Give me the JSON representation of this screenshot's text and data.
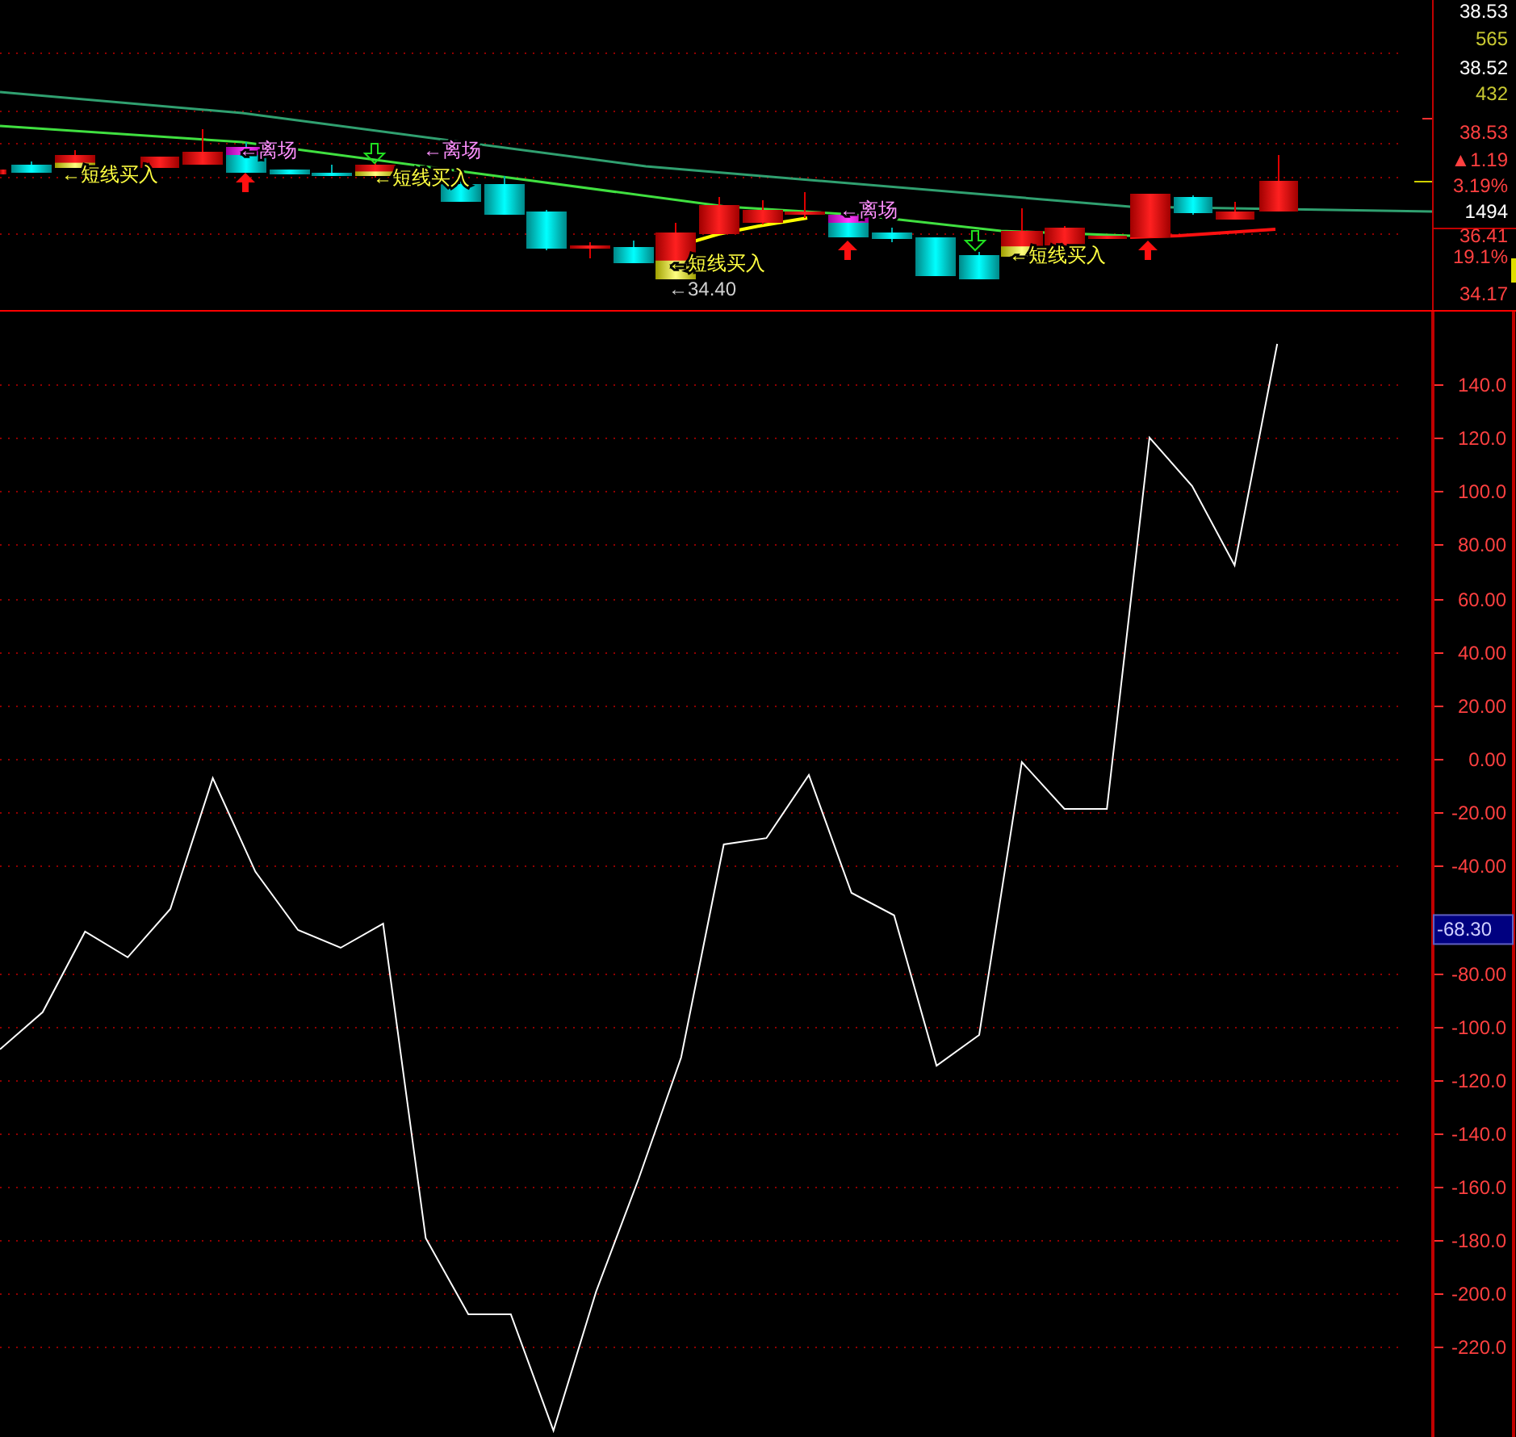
{
  "price_panel": {
    "axis_labels": [
      {
        "text": "38.53",
        "color": "#ffffff"
      },
      {
        "text": "565",
        "color": "#c8c832"
      },
      {
        "text": "38.52",
        "color": "#ffffff"
      },
      {
        "text": "432",
        "color": "#c8c832"
      },
      {
        "text": "38.53",
        "color": "#ff4040"
      },
      {
        "text": "▲1.19",
        "color": "#ff4040"
      },
      {
        "text": "3.19%",
        "color": "#ff4040"
      },
      {
        "text": "1494",
        "color": "#ffffff"
      },
      {
        "text": "36.41",
        "color": "#ff4040"
      },
      {
        "text": "19.1%",
        "color": "#ff4040"
      },
      {
        "text": "34.17",
        "color": "#ff4040"
      }
    ],
    "signals": [
      {
        "text": "←短线买入",
        "kind": "buy"
      },
      {
        "text": "←离场",
        "kind": "exit"
      },
      {
        "text": "←短线买入",
        "kind": "buy"
      },
      {
        "text": "←离场",
        "kind": "exit"
      },
      {
        "text": "←短线买入",
        "kind": "buy"
      },
      {
        "text": "←离场",
        "kind": "exit"
      },
      {
        "text": "←短线买入",
        "kind": "buy"
      }
    ],
    "low_marker": "←34.40"
  },
  "indicator_panel": {
    "cursor_value": "-68.30",
    "chart_data": {
      "type": "line",
      "categories": [
        null,
        null,
        null,
        null,
        null,
        null,
        null,
        null,
        null,
        null,
        null,
        null,
        null,
        null,
        null,
        null,
        null,
        null,
        null,
        null,
        null,
        null,
        null,
        null,
        null,
        null,
        null,
        null,
        null,
        null,
        null
      ],
      "series": [
        {
          "color": "#ffffff",
          "values": [
            -108.6,
            -94.7,
            -64.6,
            -74.2,
            -56.1,
            -7.2,
            -42.2,
            -64.0,
            -70.6,
            -61.6,
            -179.2,
            -207.6,
            -207.6,
            -251.1,
            -199.2,
            -156.9,
            -111.6,
            -32.0,
            -29.6,
            -6.0,
            -50.1,
            -58.5,
            -114.7,
            -103.2,
            -1.2,
            -18.7,
            -18.7,
            120.1,
            102.0,
            72.4,
            155.1
          ]
        }
      ],
      "grid": true,
      "ylim": [
        -253.5,
        167.2
      ],
      "yticks": [
        {
          "value": 140,
          "label": "140.0"
        },
        {
          "value": 120,
          "label": "120.0"
        },
        {
          "value": 100,
          "label": "100.0"
        },
        {
          "value": 80,
          "label": "80.00"
        },
        {
          "value": 60,
          "label": "60.00"
        },
        {
          "value": 40,
          "label": "40.00"
        },
        {
          "value": 20,
          "label": "20.00"
        },
        {
          "value": 0,
          "label": "0.00"
        },
        {
          "value": -20,
          "label": "-20.00"
        },
        {
          "value": -40,
          "label": "-40.00"
        },
        {
          "value": -80,
          "label": "-80.00"
        },
        {
          "value": -100,
          "label": "-100.0"
        },
        {
          "value": -120,
          "label": "-120.0"
        },
        {
          "value": -140,
          "label": "-140.0"
        },
        {
          "value": -160,
          "label": "-160.0"
        },
        {
          "value": -180,
          "label": "-180.0"
        },
        {
          "value": -200,
          "label": "-200.0"
        },
        {
          "value": -220,
          "label": "-220.0"
        }
      ]
    }
  }
}
